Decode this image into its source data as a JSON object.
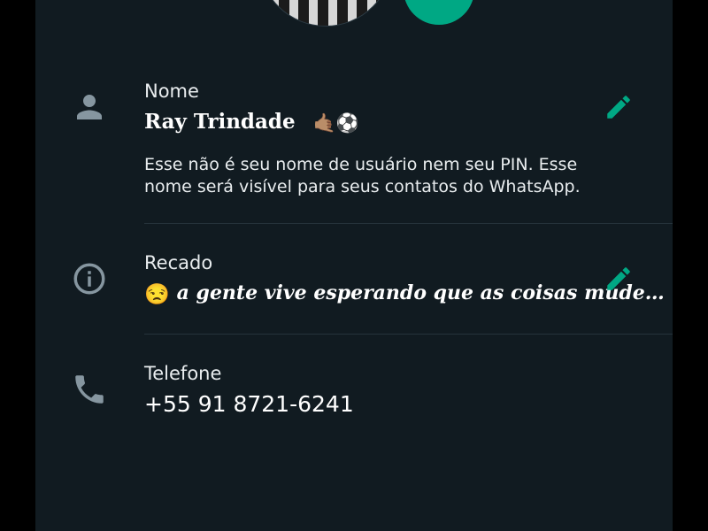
{
  "profile": {
    "name_row": {
      "label": "Nome",
      "value": "Ray Trindade",
      "value_emojis": "🤙🏽⚽",
      "hint": "Esse não é seu nome de usuário nem seu PIN. Esse nome será visível para seus contatos do WhatsApp.",
      "icon": "person-icon",
      "edit_icon": "pencil-icon"
    },
    "about_row": {
      "label": "Recado",
      "value_emoji": "😒",
      "value": "a gente vive esperando que as coisas mude…",
      "icon": "info-icon",
      "edit_icon": "pencil-icon"
    },
    "phone_row": {
      "label": "Telefone",
      "value": "+55 91 8721-6241",
      "icon": "phone-icon"
    }
  },
  "colors": {
    "background": "#111b21",
    "accent": "#00a884",
    "icon_gray": "#8696a0",
    "divider": "#26333b"
  }
}
